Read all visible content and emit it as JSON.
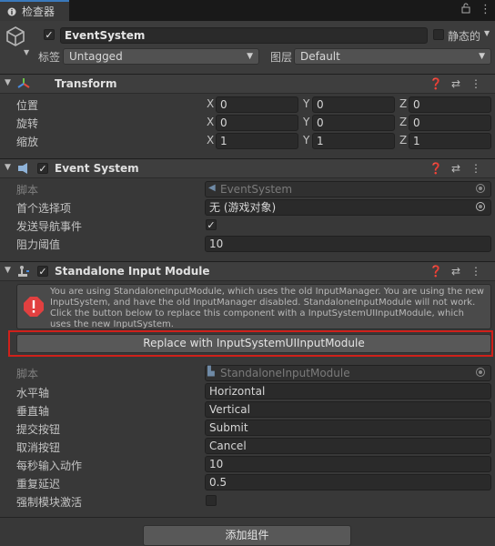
{
  "tab": {
    "title": "检查器"
  },
  "header": {
    "object_name": "EventSystem",
    "static_label": "静态的",
    "tag_label": "标签",
    "tag_value": "Untagged",
    "layer_label": "图层",
    "layer_value": "Default"
  },
  "transform": {
    "title": "Transform",
    "rows": [
      {
        "label": "位置",
        "x": "0",
        "y": "0",
        "z": "0"
      },
      {
        "label": "旋转",
        "x": "0",
        "y": "0",
        "z": "0"
      },
      {
        "label": "缩放",
        "x": "1",
        "y": "1",
        "z": "1"
      }
    ],
    "axis": {
      "x": "X",
      "y": "Y",
      "z": "Z"
    }
  },
  "event_system": {
    "title": "Event System",
    "script_label": "脚本",
    "script_value": "EventSystem",
    "first_selected_label": "首个选择项",
    "first_selected_value": "无 (游戏对象)",
    "send_nav_label": "发送导航事件",
    "drag_threshold_label": "阻力阈值",
    "drag_threshold_value": "10"
  },
  "standalone": {
    "title": "Standalone Input Module",
    "warning": "You are using StandaloneInputModule, which uses the old InputManager. You are using the new InputSystem, and have the old InputManager disabled. StandaloneInputModule will not work. Click the button below to replace this component with a InputSystemUIInputModule, which uses the new InputSystem.",
    "replace_button": "Replace with InputSystemUIInputModule",
    "script_label": "脚本",
    "script_value": "StandaloneInputModule",
    "rows": [
      {
        "label": "水平轴",
        "value": "Horizontal"
      },
      {
        "label": "垂直轴",
        "value": "Vertical"
      },
      {
        "label": "提交按钮",
        "value": "Submit"
      },
      {
        "label": "取消按钮",
        "value": "Cancel"
      },
      {
        "label": "每秒输入动作",
        "value": "10"
      },
      {
        "label": "重复延迟",
        "value": "0.5"
      }
    ],
    "force_active_label": "强制模块激活"
  },
  "add_component": "添加组件",
  "colors": {
    "accent": "#3a79bb",
    "warning_red": "#d0201a",
    "error_icon": "#e14040"
  }
}
